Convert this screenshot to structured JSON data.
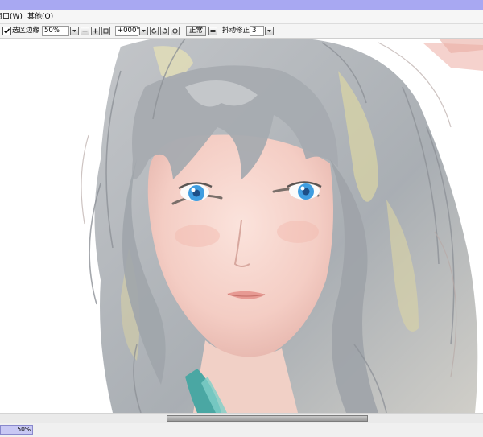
{
  "menu": {
    "window_label": "窗口(W)",
    "other_label": "其他(O)"
  },
  "toolbar": {
    "selection_edge_checked": true,
    "selection_edge_label": "选区边缘",
    "zoom_value": "50%",
    "rotation_value": "+000°",
    "view_mode_label": "正常",
    "stabilizer_label": "抖动修正",
    "stabilizer_value": "3"
  },
  "status": {
    "zoom_percent": "50%",
    "zoom_fill_fraction": 0.5
  },
  "icons": [
    "checkmark-icon",
    "dropdown-arrow-icon",
    "zoom-out-icon",
    "zoom-in-icon",
    "zoom-reset-icon",
    "rotate-left-icon",
    "rotate-right-icon",
    "rotate-reset-icon",
    "flip-icon"
  ]
}
